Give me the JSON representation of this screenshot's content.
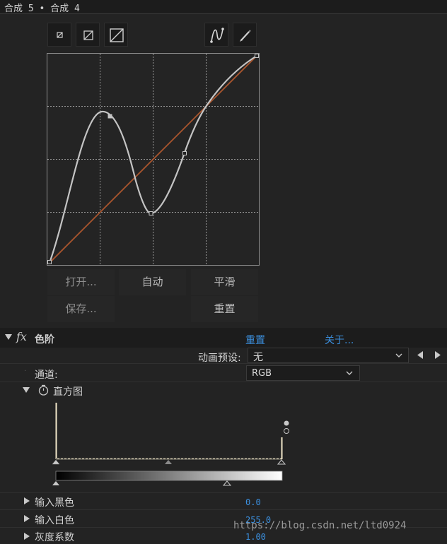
{
  "window": {
    "tab_title": "合成 5 • 合成 4"
  },
  "curves": {
    "buttons": {
      "open": "打开...",
      "auto": "自动",
      "smooth": "平滑",
      "save": "保存...",
      "reset": "重置"
    }
  },
  "effect": {
    "fx": "fx",
    "name": "色阶",
    "reset": "重置",
    "about": "关于...",
    "preset_label": "动画预设:",
    "preset_value": "无",
    "channel_label": "通道:",
    "channel_value": "RGB",
    "histogram_label": "直方图",
    "props": [
      {
        "label": "输入黑色",
        "value": "0.0"
      },
      {
        "label": "输入白色",
        "value": "255.0"
      },
      {
        "label": "灰度系数",
        "value": "1.00"
      }
    ]
  },
  "watermark": "https://blog.csdn.net/ltd0924",
  "colors": {
    "accent": "#3b8fde",
    "diagonal": "#a0522d",
    "curve": "#c4c4c4"
  }
}
